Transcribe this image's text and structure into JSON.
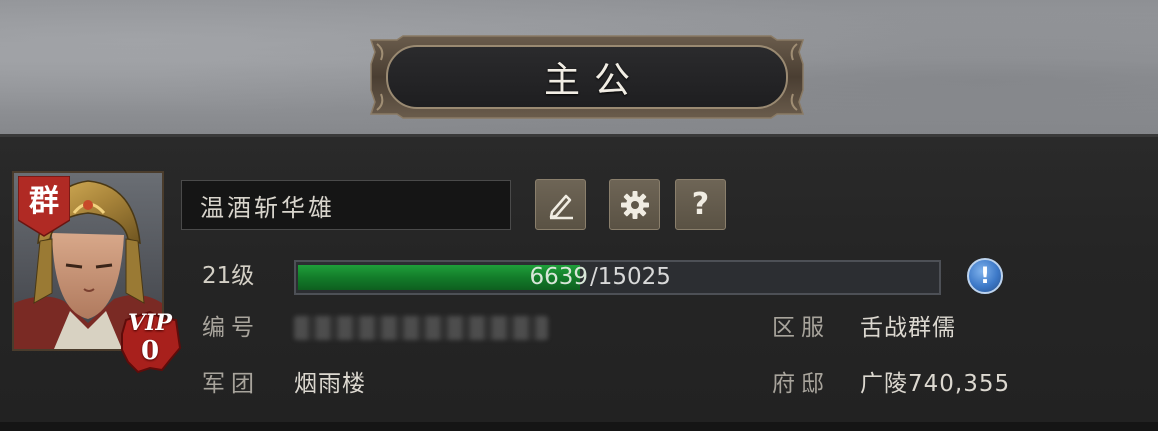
{
  "header": {
    "title": "主公"
  },
  "player": {
    "faction": "群",
    "vip_label": "VIP",
    "vip_level": "0",
    "name": "温酒斩华雄",
    "level_label": "21级",
    "exp_current": "6639",
    "exp_max": "/15025",
    "exp_fraction": 0.4419
  },
  "info": {
    "id_label": "编号",
    "legion_label": "军团",
    "legion_value": "烟雨楼",
    "server_label": "区服",
    "server_value": "舌战群儒",
    "mansion_label": "府邸",
    "mansion_value": "广陵740,355"
  },
  "buttons": {
    "help_glyph": "?",
    "info_glyph": "!"
  },
  "icons": {
    "edit": "pencil-icon",
    "settings": "gear-icon",
    "help": "question-icon",
    "info": "exclamation-icon"
  },
  "colors": {
    "progress": "#1a8a32",
    "faction_badge": "#b02a24",
    "vip_badge": "#a8201c",
    "info_button": "#3d79c8"
  }
}
